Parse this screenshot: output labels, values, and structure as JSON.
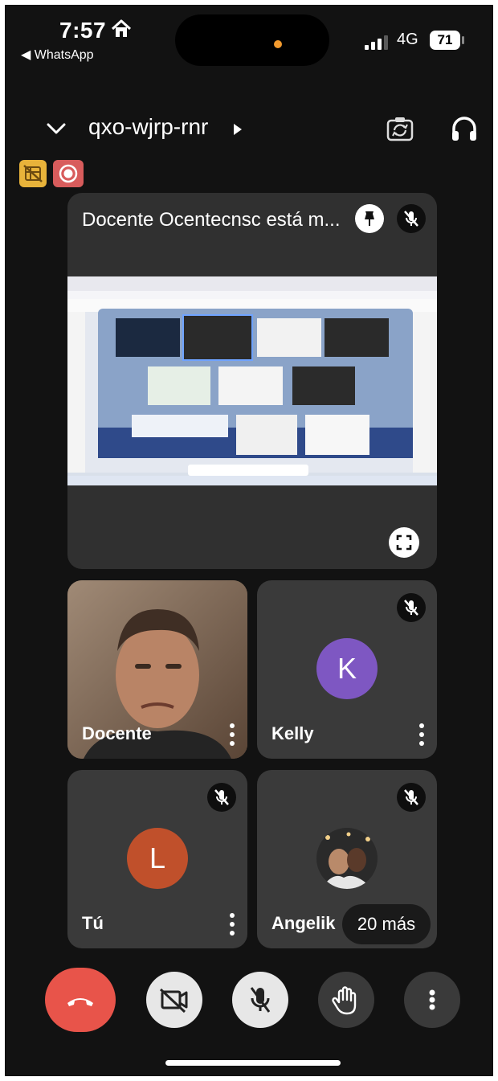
{
  "status_bar": {
    "time": "7:57",
    "back_app": "◀ WhatsApp",
    "network": "4G",
    "battery": "71"
  },
  "meeting": {
    "code": "qxo-wjrp-rnr"
  },
  "presentation": {
    "title": "Docente Ocentecnsc está m..."
  },
  "participants": [
    {
      "name": "Docente",
      "has_video": true,
      "muted": false
    },
    {
      "name": "Kelly",
      "initial": "K",
      "avatar_color": "#7e57c2",
      "muted": true
    },
    {
      "name": "Tú",
      "initial": "L",
      "avatar_color": "#c0502b",
      "muted": true
    },
    {
      "name": "Angelik",
      "muted": true
    }
  ],
  "more_participants": "20 más",
  "colors": {
    "end_call": "#e8544a",
    "background": "#121212",
    "tile": "#3a3a3a"
  }
}
